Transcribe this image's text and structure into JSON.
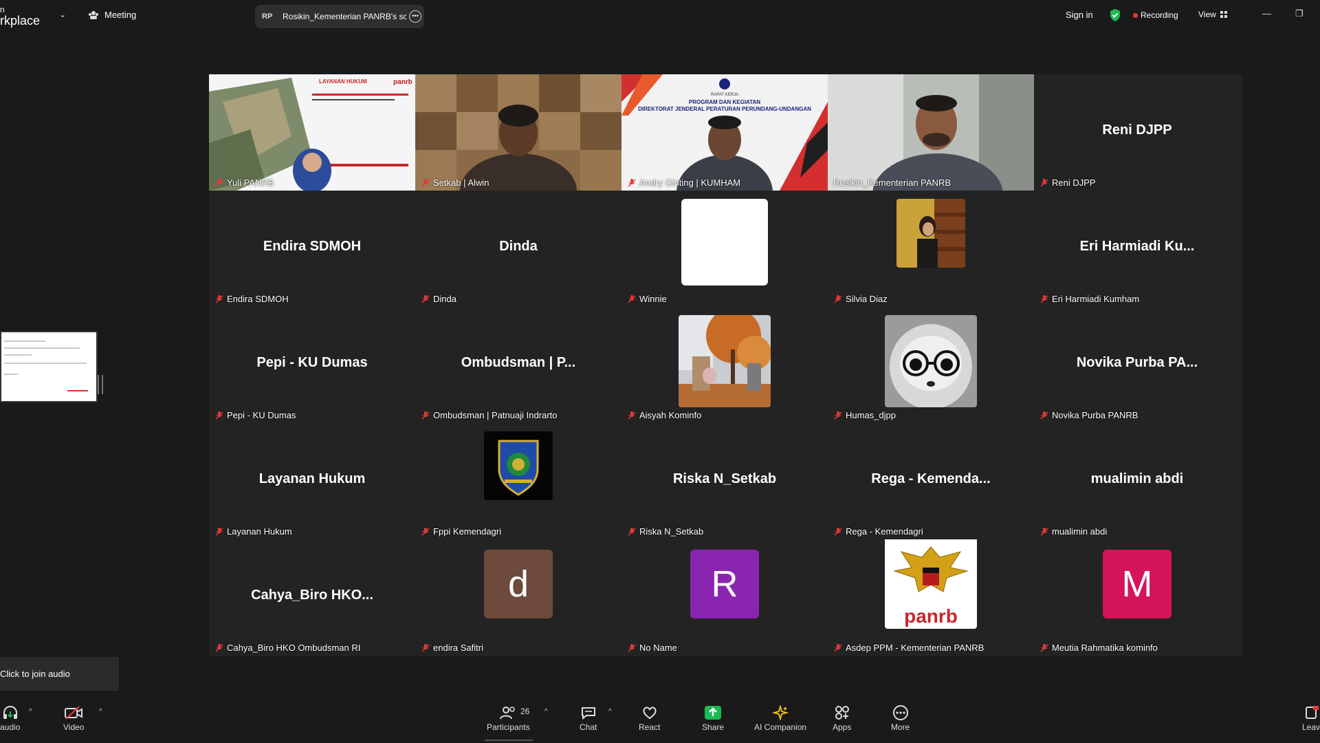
{
  "topbar": {
    "brand_line1": "n",
    "brand_line2": "rkplace",
    "meeting_label": "Meeting",
    "share_initials": "RP",
    "share_title": "Rosikin_Kementerian PANRB's sc",
    "signin": "Sign in",
    "recording": "Recording",
    "view": "View"
  },
  "tiles": {
    "yuli": {
      "label": "Yuli PANRB",
      "slide_title": "LAYANAN HUKUM",
      "slide_logo": "panrb"
    },
    "alwin": {
      "label": "Setkab | Alwin"
    },
    "andry": {
      "label": "Andry Ginting | KUMHAM",
      "bg_line1": "RAPAT KERJA",
      "bg_line2": "PROGRAM DAN KEGIATAN",
      "bg_line3": "DIREKTORAT JENDERAL PERATURAN PERUNDANG-UNDANGAN"
    },
    "rosikin": {
      "label": "Rosikin_Kementerian PANRB"
    },
    "reni": {
      "name": "Reni DJPP",
      "label": "Reni DJPP"
    },
    "endira": {
      "name": "Endira SDMOH",
      "label": "Endira SDMOH"
    },
    "dinda": {
      "name": "Dinda",
      "label": "Dinda"
    },
    "winnie": {
      "label": "Winnie"
    },
    "silvia": {
      "label": "Silvia Diaz"
    },
    "eri": {
      "name": "Eri Harmiadi Ku...",
      "label": "Eri Harmiadi Kumham"
    },
    "pepi": {
      "name": "Pepi - KU Dumas",
      "label": "Pepi - KU Dumas"
    },
    "ombudsman": {
      "name": "Ombudsman | P...",
      "label": "Ombudsman | Patnuaji Indrarto"
    },
    "aisyah": {
      "label": "Aisyah Kominfo"
    },
    "humas": {
      "label": "Humas_djpp"
    },
    "novika": {
      "name": "Novika Purba PA...",
      "label": "Novika Purba PANRB"
    },
    "layanan": {
      "name": "Layanan Hukum",
      "label": "Layanan Hukum"
    },
    "fppi": {
      "label": "Fppi Kemendagri"
    },
    "riska": {
      "name": "Riska N_Setkab",
      "label": "Riska N_Setkab"
    },
    "rega": {
      "name": "Rega - Kemenda...",
      "label": "Rega - Kemendagri"
    },
    "mualimin": {
      "name": "mualimin abdi",
      "label": "mualimin abdi"
    },
    "cahya": {
      "name": "Cahya_Biro HKO...",
      "label": "Cahya_Biro HKO Ombudsman RI"
    },
    "endira_s": {
      "initial": "d",
      "label": "endira Safitri",
      "color": "#6d4a3c"
    },
    "noname": {
      "initial": "R",
      "label": "No Name",
      "color": "#8a25b1"
    },
    "asdep": {
      "logo_text": "panrb",
      "label": "Asdep PPM - Kementerian PANRB"
    },
    "meutia": {
      "initial": "M",
      "label": "Meutia Rahmatika kominfo",
      "color": "#d4145a"
    }
  },
  "sidebar": {
    "join_audio": "Click to join audio"
  },
  "toolbar": {
    "audio": "audio",
    "video": "Video",
    "participants": "Participants",
    "participants_count": "26",
    "chat": "Chat",
    "react": "React",
    "share": "Share",
    "ai": "AI Companion",
    "apps": "Apps",
    "more": "More",
    "leave": "Leav"
  },
  "colors": {
    "speaking_border": "#2ed47a",
    "recording_dot": "#e53935",
    "share_green": "#1db954",
    "muted_red": "#e53935"
  }
}
